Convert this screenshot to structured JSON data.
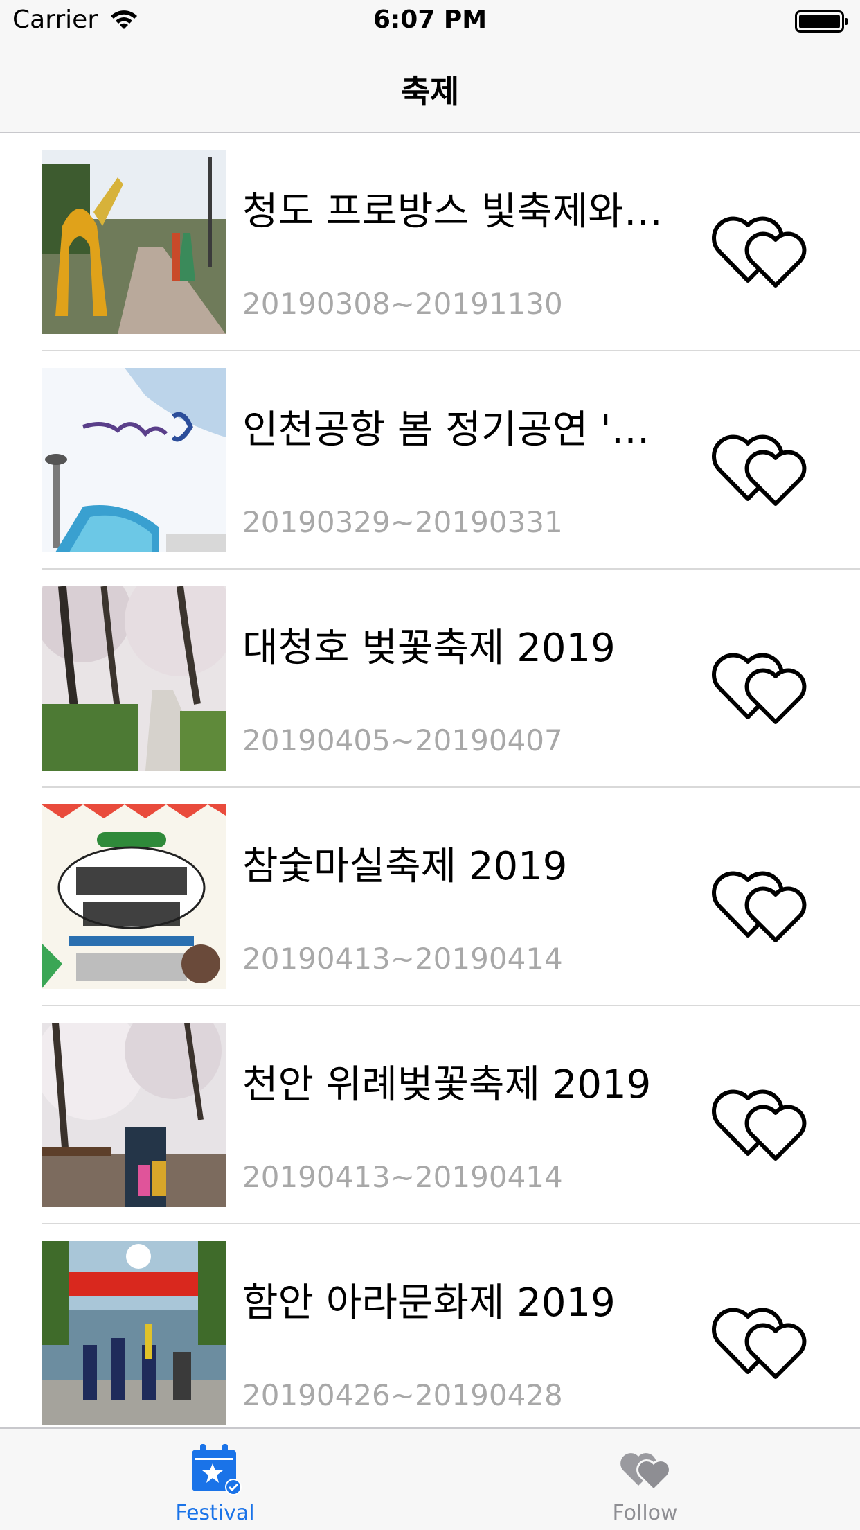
{
  "status_bar": {
    "carrier": "Carrier",
    "time": "6:07 PM"
  },
  "nav": {
    "title": "축제"
  },
  "festivals": [
    {
      "title": "청도 프로방스 빛축제와 달빛정원",
      "date": "20190308~20191130",
      "image": "provence-thumbnail"
    },
    {
      "title": "인천공항 봄 정기공연 'Hello Spring'",
      "date": "20190329~20190331",
      "image": "incheon-airport-poster"
    },
    {
      "title": "대청호 벚꽃축제 2019",
      "date": "20190405~20190407",
      "image": "cherry-blossom-road"
    },
    {
      "title": "참숯마실축제 2019",
      "date": "20190413~20190414",
      "image": "charcoal-festival-poster"
    },
    {
      "title": "천안 위례벚꽃축제 2019",
      "date": "20190413~20190414",
      "image": "cherry-blossom-children"
    },
    {
      "title": "함안 아라문화제 2019",
      "date": "20190426~20190428",
      "image": "parade-banner"
    }
  ],
  "tabs": [
    {
      "label": "Festival",
      "icon": "calendar-star-icon",
      "active": true
    },
    {
      "label": "Follow",
      "icon": "hearts-icon",
      "active": false
    }
  ],
  "colors": {
    "accent": "#1a73e8",
    "inactive": "#8e8e93",
    "date_text": "#a8a8a8"
  }
}
